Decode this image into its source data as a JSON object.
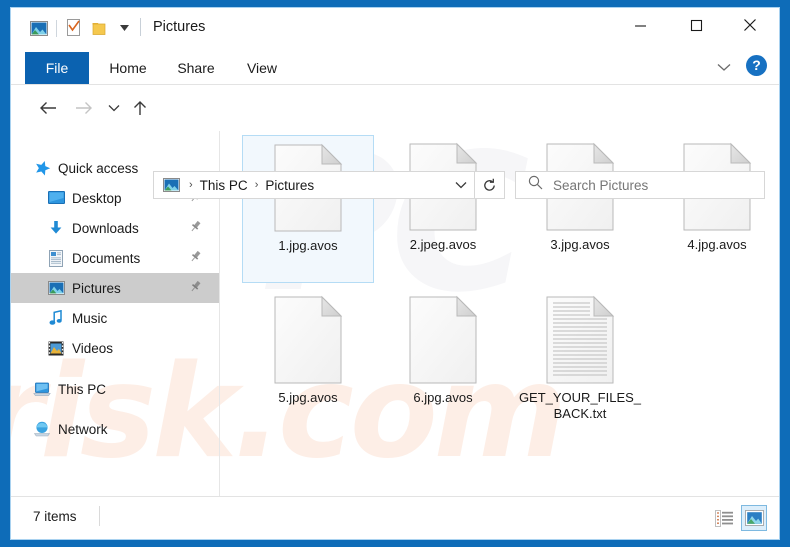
{
  "window": {
    "title": "Pictures",
    "quick_access_toolbar": [
      {
        "name": "pictures-icon",
        "label": "Pictures"
      },
      {
        "name": "properties-icon",
        "label": "Properties"
      },
      {
        "name": "new-folder-icon",
        "label": "New folder"
      },
      {
        "name": "customize-dropdown-icon",
        "label": "Customize Quick Access Toolbar"
      }
    ],
    "controls": {
      "minimize": "—",
      "maximize": "☐",
      "close": "✕"
    }
  },
  "ribbon": {
    "tabs": [
      {
        "label": "File",
        "selected": true
      },
      {
        "label": "Home",
        "selected": false
      },
      {
        "label": "Share",
        "selected": false
      },
      {
        "label": "View",
        "selected": false
      }
    ],
    "collapse_icon": "⌄",
    "help_label": "?"
  },
  "navigation": {
    "back_icon": "←",
    "forward_icon": "→",
    "recent_icon": "⌄",
    "up_icon": "↑",
    "refresh_icon": "↻",
    "breadcrumb": [
      "This PC",
      "Pictures"
    ],
    "breadcrumb_separator": "›",
    "address_dropdown_icon": "⌄"
  },
  "search": {
    "placeholder": "Search Pictures",
    "icon": "search-icon"
  },
  "sidebar": {
    "items": [
      {
        "label": "Quick access",
        "icon": "star-icon",
        "level": 0,
        "selected": false,
        "pinned": false
      },
      {
        "label": "Desktop",
        "icon": "desktop-icon",
        "level": 1,
        "selected": false,
        "pinned": true
      },
      {
        "label": "Downloads",
        "icon": "download-icon",
        "level": 1,
        "selected": false,
        "pinned": true
      },
      {
        "label": "Documents",
        "icon": "document-icon",
        "level": 1,
        "selected": false,
        "pinned": true
      },
      {
        "label": "Pictures",
        "icon": "pictures-icon",
        "level": 1,
        "selected": true,
        "pinned": true
      },
      {
        "label": "Music",
        "icon": "music-icon",
        "level": 1,
        "selected": false,
        "pinned": false
      },
      {
        "label": "Videos",
        "icon": "video-icon",
        "level": 1,
        "selected": false,
        "pinned": false
      },
      {
        "label": "This PC",
        "icon": "this-pc-icon",
        "level": 0,
        "selected": false,
        "pinned": false
      },
      {
        "label": "Network",
        "icon": "network-icon",
        "level": 0,
        "selected": false,
        "pinned": false
      }
    ]
  },
  "files": [
    {
      "name": "1.jpg.avos",
      "icon": "blank-file-icon",
      "selected": true
    },
    {
      "name": "2.jpeg.avos",
      "icon": "blank-file-icon",
      "selected": false
    },
    {
      "name": "3.jpg.avos",
      "icon": "blank-file-icon",
      "selected": false
    },
    {
      "name": "4.jpg.avos",
      "icon": "blank-file-icon",
      "selected": false
    },
    {
      "name": "5.jpg.avos",
      "icon": "blank-file-icon",
      "selected": false
    },
    {
      "name": "6.jpg.avos",
      "icon": "blank-file-icon",
      "selected": false
    },
    {
      "name": "GET_YOUR_FILES_BACK.txt",
      "icon": "text-file-icon",
      "selected": false
    }
  ],
  "statusbar": {
    "item_count": "7 items",
    "view_details_label": "Details view",
    "view_icons_label": "Large icons view"
  },
  "watermark": {
    "text_lower": "risk.com",
    "text_upper": "PC"
  },
  "colors": {
    "window_frame_blue": "#0e6cb8",
    "file_tab_blue": "#0b62b0",
    "selection_blue": "#f2f8fd",
    "selection_border": "#b5dcf5",
    "sidebar_selected_gray": "#cccccc",
    "help_blue": "#1771c2"
  }
}
